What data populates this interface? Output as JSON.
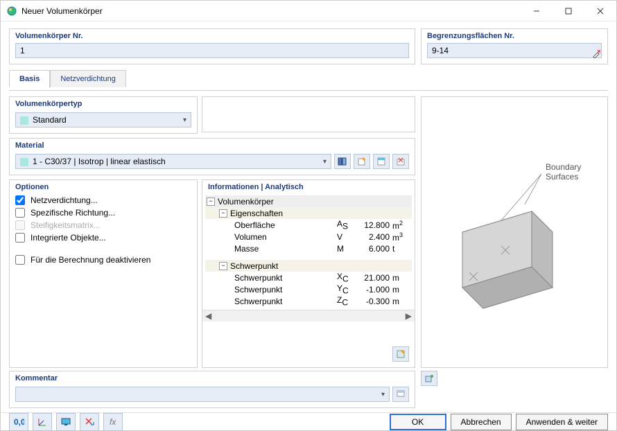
{
  "window": {
    "title": "Neuer Volumenkörper"
  },
  "header": {
    "volume_no_label": "Volumenkörper Nr.",
    "volume_no_value": "1",
    "boundary_label": "Begrenzungsflächen Nr.",
    "boundary_value": "9-14"
  },
  "tabs": {
    "basis": "Basis",
    "mesh": "Netzverdichtung"
  },
  "type_group": {
    "title": "Volumenkörpertyp",
    "value": "Standard"
  },
  "material_group": {
    "title": "Material",
    "value": "1 - C30/37 | Isotrop | linear elastisch"
  },
  "options": {
    "title": "Optionen",
    "mesh_refinement": "Netzverdichtung...",
    "specific_direction": "Spezifische Richtung...",
    "stiffness_matrix": "Steifigkeitsmatrix...",
    "integrated_objects": "Integrierte Objekte...",
    "deactivate": "Für die Berechnung deaktivieren"
  },
  "info": {
    "title": "Informationen | Analytisch",
    "node_volume": "Volumenkörper",
    "node_props": "Eigenschaften",
    "rows_props": [
      {
        "name": "Oberfläche",
        "sym": "A",
        "sub": "S",
        "val": "12.800",
        "unit": "m",
        "sup": "2"
      },
      {
        "name": "Volumen",
        "sym": "V",
        "sub": "",
        "val": "2.400",
        "unit": "m",
        "sup": "3"
      },
      {
        "name": "Masse",
        "sym": "M",
        "sub": "",
        "val": "6.000",
        "unit": "t",
        "sup": ""
      }
    ],
    "node_centroid": "Schwerpunkt",
    "rows_centroid": [
      {
        "name": "Schwerpunkt",
        "sym": "X",
        "sub": "C",
        "val": "21.000",
        "unit": "m"
      },
      {
        "name": "Schwerpunkt",
        "sym": "Y",
        "sub": "C",
        "val": "-1.000",
        "unit": "m"
      },
      {
        "name": "Schwerpunkt",
        "sym": "Z",
        "sub": "C",
        "val": "-0.300",
        "unit": "m"
      }
    ]
  },
  "comment": {
    "title": "Kommentar",
    "value": ""
  },
  "preview": {
    "label1": "Boundary",
    "label2": "Surfaces"
  },
  "buttons": {
    "ok": "OK",
    "cancel": "Abbrechen",
    "apply": "Anwenden & weiter"
  }
}
